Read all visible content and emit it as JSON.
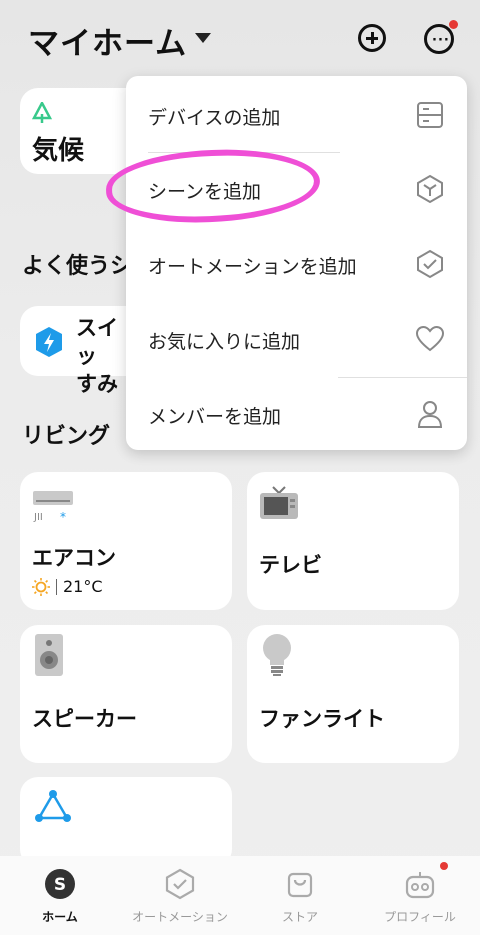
{
  "header": {
    "home_title": "マイホーム"
  },
  "weather_card": {
    "label": "気候"
  },
  "sections": {
    "frequent_scenes": "よく使うシ",
    "living": "リビング"
  },
  "scene_card": {
    "label": "スイッ\nすみ"
  },
  "devices": [
    {
      "name": "エアコン",
      "status_temp": "21°C"
    },
    {
      "name": "テレビ"
    },
    {
      "name": "スピーカー"
    },
    {
      "name": "ファンライト"
    }
  ],
  "menu": {
    "items": [
      {
        "label": "デバイスの追加",
        "icon": "device-panel-icon"
      },
      {
        "label": "シーンを追加",
        "icon": "scene-cube-icon"
      },
      {
        "label": "オートメーションを追加",
        "icon": "automation-shield-icon"
      },
      {
        "label": "お気に入りに追加",
        "icon": "heart-icon"
      },
      {
        "label": "メンバーを追加",
        "icon": "person-icon"
      }
    ]
  },
  "bottom_nav": {
    "items": [
      {
        "label": "ホーム",
        "active": true
      },
      {
        "label": "オートメーション",
        "active": false
      },
      {
        "label": "ストア",
        "active": false
      },
      {
        "label": "プロフィール",
        "active": false
      }
    ]
  },
  "colors": {
    "highlight": "#ef4fd6",
    "notification": "#e53935",
    "scene_icon": "#1e9be9"
  }
}
